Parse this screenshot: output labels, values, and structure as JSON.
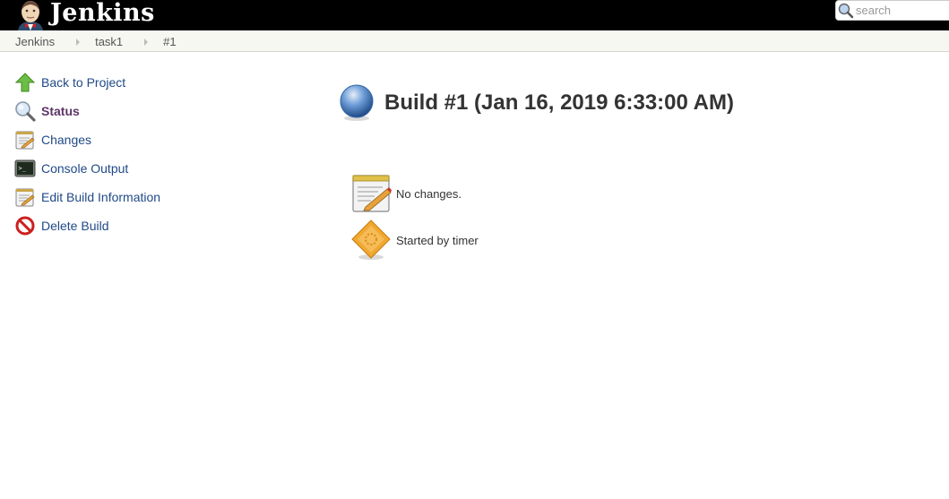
{
  "header": {
    "app_title": "Jenkins",
    "search": {
      "placeholder": "search",
      "value": "",
      "icon": "search-icon"
    }
  },
  "breadcrumbs": [
    {
      "label": "Jenkins"
    },
    {
      "label": "task1"
    },
    {
      "label": "#1"
    }
  ],
  "side_panel": {
    "tasks": [
      {
        "label": "Back to Project",
        "icon": "up-arrow-icon",
        "active": false
      },
      {
        "label": "Status",
        "icon": "magnifier-icon",
        "active": true
      },
      {
        "label": "Changes",
        "icon": "notepad-icon",
        "active": false
      },
      {
        "label": "Console Output",
        "icon": "terminal-icon",
        "active": false
      },
      {
        "label": "Edit Build Information",
        "icon": "notepad-icon",
        "active": false
      },
      {
        "label": "Delete Build",
        "icon": "no-entry-icon",
        "active": false
      }
    ]
  },
  "main": {
    "build_title": "Build #1 (Jan 16, 2019 6:33:00 AM)",
    "build_status_icon": "blue-ball-icon",
    "status_color": "#3465a4",
    "summary": [
      {
        "text": "No changes.",
        "icon": "notepad-icon"
      },
      {
        "text": "Started by timer",
        "icon": "timer-cause-icon"
      }
    ]
  }
}
